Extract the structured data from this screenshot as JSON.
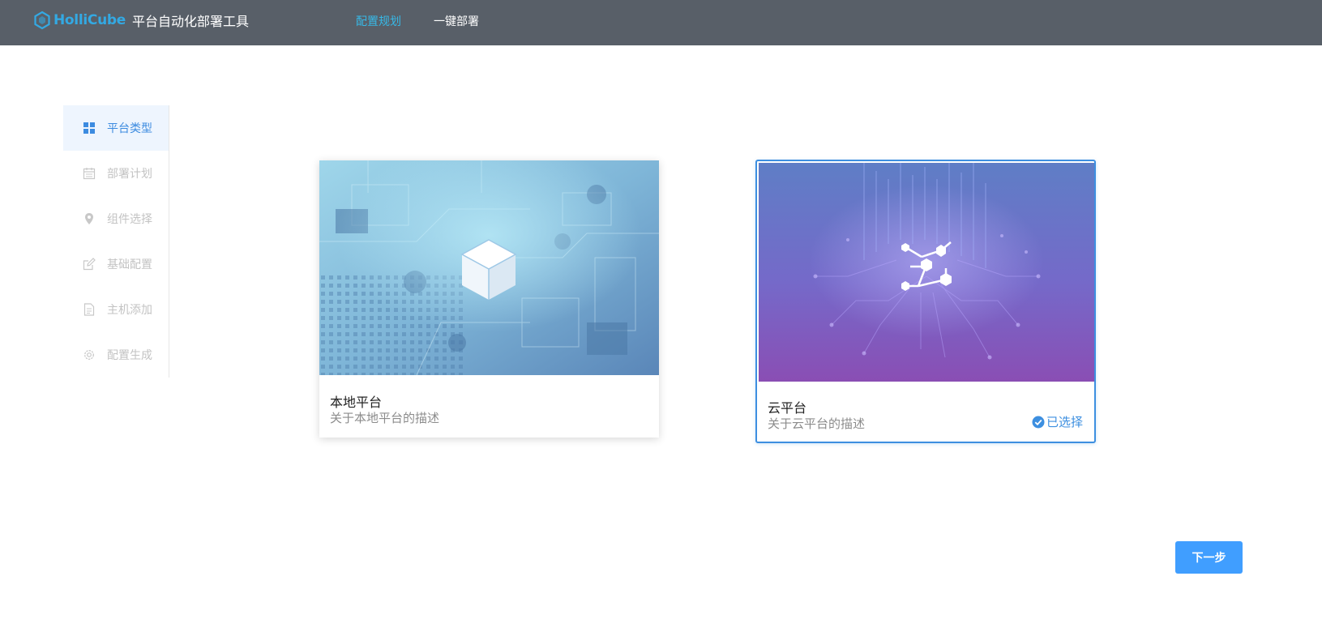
{
  "header": {
    "brand": "HolliCube",
    "title": "平台自动化部署工具",
    "nav": [
      {
        "label": "配置规划",
        "active": true
      },
      {
        "label": "一键部署",
        "active": false
      }
    ]
  },
  "steps": [
    {
      "label": "平台类型",
      "icon": "grid-icon",
      "active": true
    },
    {
      "label": "部署计划",
      "icon": "calendar-icon",
      "active": false
    },
    {
      "label": "组件选择",
      "icon": "location-pin-icon",
      "active": false
    },
    {
      "label": "基础配置",
      "icon": "edit-icon",
      "active": false
    },
    {
      "label": "主机添加",
      "icon": "document-icon",
      "active": false
    },
    {
      "label": "配置生成",
      "icon": "gear-icon",
      "active": false
    }
  ],
  "cards": {
    "local": {
      "title": "本地平台",
      "description": "关于本地平台的描述",
      "image": "circuit-board-cube-image",
      "selected": false
    },
    "cloud": {
      "title": "云平台",
      "description": "关于云平台的描述",
      "image": "cloud-circuit-network-image",
      "selected": true,
      "selected_label": "已选择"
    }
  },
  "next_button": "下一步",
  "colors": {
    "header_bg": "#585f68",
    "brand": "#33a9e3",
    "nav_active": "#37b8e6",
    "accent": "#3d8fe0",
    "button": "#409eff"
  }
}
